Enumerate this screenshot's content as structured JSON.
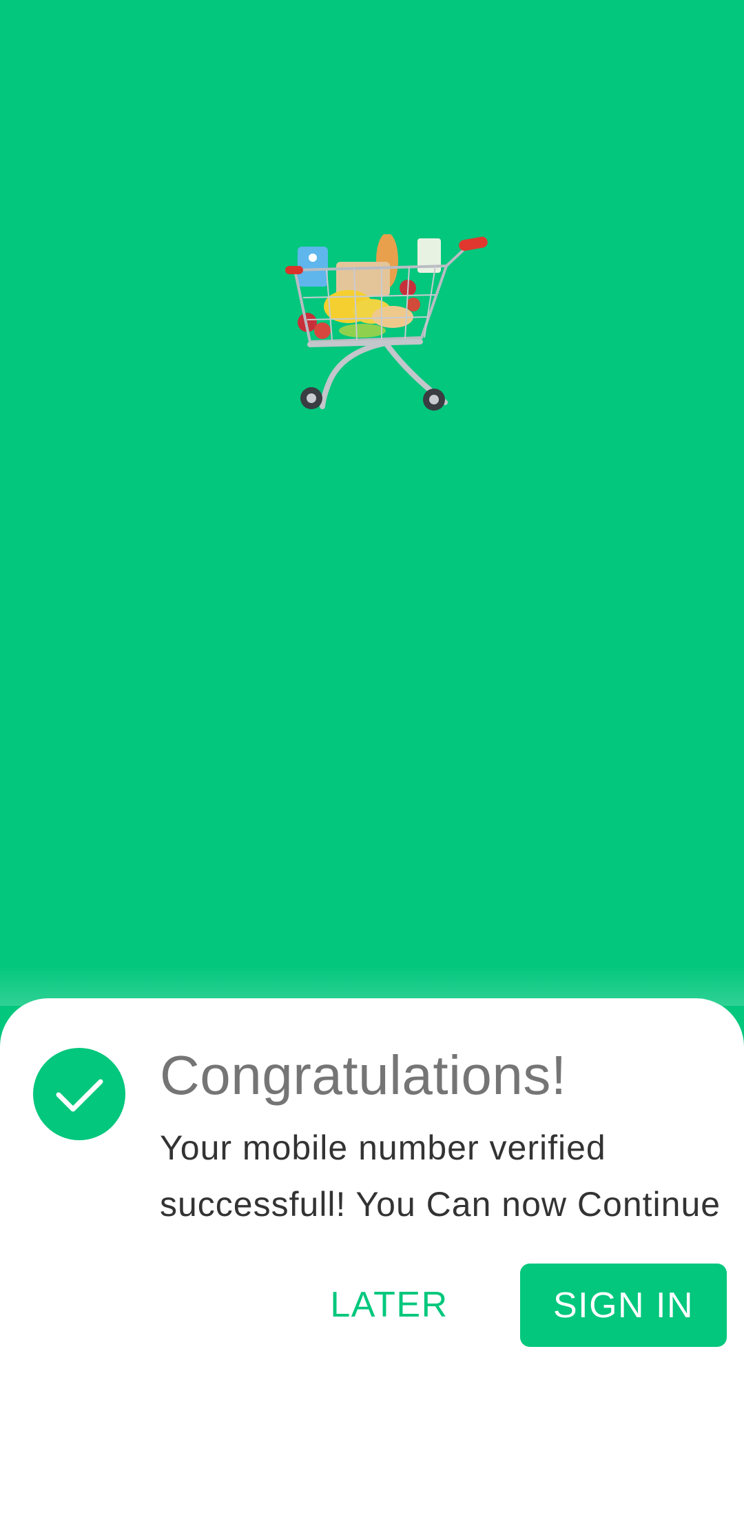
{
  "theme": {
    "accent": "#02c77d",
    "sheet_background": "#ffffff",
    "title_color": "#757575",
    "message_color": "#333333"
  },
  "hero": {
    "illustration": "shopping-cart-with-groceries"
  },
  "dialog": {
    "icon": "check-circle-icon",
    "title": "Congratulations!",
    "message": "Your mobile number verified successfull! You Can now Continue",
    "later_label": "LATER",
    "signin_label": "SIGN IN"
  }
}
